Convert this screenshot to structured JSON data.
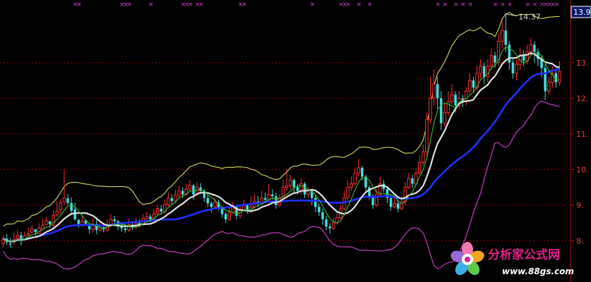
{
  "chart_data": {
    "type": "candlestick",
    "y_axis_side": "right",
    "ylim": [
      7.0,
      14.6
    ],
    "grid": "horizontal-dashed",
    "y_ticks": [
      "13.",
      "12.",
      "11.",
      "10.",
      "9.",
      "8."
    ],
    "y_tick_values": [
      13,
      12,
      11,
      10,
      9,
      8
    ],
    "last_price_label": "13.92",
    "last_price_value": 13.92,
    "high_label": "14.37",
    "high_value": 14.37,
    "high_index": 140,
    "n_bars": 156,
    "colors": {
      "background": "#000000",
      "up": "#ff3030",
      "down": "#40e0e0",
      "axis": "#b01010",
      "grid": "#8b0000",
      "upper_band": "#d8d860",
      "lower_band": "#c040c0",
      "ma_long": "#2030ff",
      "ma_mid": "#e0e0e0",
      "ma_short": "#30c030",
      "marker": "#cc44cc"
    },
    "signal_marker": "×",
    "signal_marker_indices": [
      20,
      21,
      33,
      34,
      35,
      41,
      50,
      51,
      52,
      54,
      55,
      66,
      67,
      86,
      94,
      95,
      96,
      99,
      102,
      121,
      123,
      126,
      128,
      130,
      137,
      139,
      141,
      146,
      148,
      150,
      151,
      152,
      153,
      154
    ],
    "candles": [
      [
        7.92,
        8.06,
        8.15,
        7.81
      ],
      [
        8.06,
        7.96,
        8.19,
        7.88
      ],
      [
        7.93,
        7.9,
        8.08,
        7.8
      ],
      [
        7.96,
        8.03,
        8.22,
        7.89
      ],
      [
        8.06,
        8.15,
        8.3,
        7.99
      ],
      [
        8.15,
        8.02,
        8.25,
        7.87
      ],
      [
        8.03,
        8.14,
        8.26,
        8.03
      ],
      [
        8.16,
        8.2,
        8.38,
        8.1
      ],
      [
        8.24,
        8.33,
        8.44,
        8.22
      ],
      [
        8.32,
        8.24,
        8.33,
        8.14
      ],
      [
        8.2,
        8.36,
        8.49,
        8.19
      ],
      [
        8.33,
        8.44,
        8.62,
        8.31
      ],
      [
        8.46,
        8.56,
        8.66,
        8.45
      ],
      [
        8.55,
        8.46,
        8.56,
        8.36
      ],
      [
        8.44,
        8.71,
        8.86,
        8.31
      ],
      [
        8.73,
        8.82,
        9.12,
        8.68
      ],
      [
        8.87,
        9.06,
        9.16,
        8.76
      ],
      [
        9.1,
        9.2,
        10.0,
        9.03
      ],
      [
        9.19,
        9.06,
        9.31,
        9.0
      ],
      [
        9.06,
        8.84,
        9.22,
        8.72
      ],
      [
        8.88,
        8.6,
        9.06,
        8.56
      ],
      [
        8.59,
        8.47,
        8.6,
        8.36
      ],
      [
        8.44,
        8.54,
        8.71,
        8.39
      ],
      [
        8.57,
        8.48,
        8.6,
        8.42
      ],
      [
        8.45,
        8.32,
        8.48,
        8.2
      ],
      [
        8.32,
        8.46,
        8.63,
        8.22
      ],
      [
        8.47,
        8.3,
        8.6,
        8.18
      ],
      [
        8.3,
        8.36,
        8.54,
        8.25
      ],
      [
        8.38,
        8.32,
        8.5,
        8.24
      ],
      [
        8.3,
        8.45,
        8.61,
        8.25
      ],
      [
        8.45,
        8.6,
        8.75,
        8.4
      ],
      [
        8.6,
        8.55,
        8.7,
        8.48
      ],
      [
        8.55,
        8.4,
        8.58,
        8.3
      ],
      [
        8.4,
        8.35,
        8.5,
        8.25
      ],
      [
        8.35,
        8.3,
        8.46,
        8.22
      ],
      [
        8.3,
        8.45,
        8.6,
        8.25
      ],
      [
        8.45,
        8.38,
        8.55,
        8.3
      ],
      [
        8.38,
        8.5,
        8.65,
        8.33
      ],
      [
        8.5,
        8.46,
        8.6,
        8.38
      ],
      [
        8.46,
        8.62,
        8.75,
        8.42
      ],
      [
        8.62,
        8.68,
        8.82,
        8.56
      ],
      [
        8.68,
        8.6,
        8.75,
        8.52
      ],
      [
        8.6,
        8.76,
        8.9,
        8.55
      ],
      [
        8.76,
        8.9,
        9.02,
        8.7
      ],
      [
        8.9,
        8.82,
        9.0,
        8.74
      ],
      [
        8.82,
        9.02,
        9.15,
        8.76
      ],
      [
        9.02,
        9.2,
        9.35,
        8.96
      ],
      [
        9.2,
        9.12,
        9.3,
        9.0
      ],
      [
        9.12,
        9.28,
        9.44,
        9.05
      ],
      [
        9.28,
        9.4,
        9.55,
        9.2
      ],
      [
        9.4,
        9.3,
        9.5,
        9.2
      ],
      [
        9.3,
        9.45,
        9.6,
        9.25
      ],
      [
        9.45,
        9.55,
        9.7,
        9.38
      ],
      [
        9.55,
        9.3,
        9.6,
        9.15
      ],
      [
        9.3,
        9.5,
        9.65,
        9.25
      ],
      [
        9.5,
        9.4,
        9.62,
        9.3
      ],
      [
        9.4,
        9.2,
        9.45,
        9.1
      ],
      [
        9.2,
        9.05,
        9.3,
        8.95
      ],
      [
        9.05,
        8.95,
        9.1,
        8.8
      ],
      [
        8.95,
        9.08,
        9.2,
        8.9
      ],
      [
        9.08,
        8.9,
        9.15,
        8.85
      ],
      [
        8.9,
        8.75,
        8.95,
        8.65
      ],
      [
        8.75,
        8.6,
        8.8,
        8.5
      ],
      [
        8.6,
        8.8,
        8.95,
        8.55
      ],
      [
        8.8,
        8.95,
        9.1,
        8.75
      ],
      [
        8.95,
        8.7,
        9.0,
        8.6
      ],
      [
        8.7,
        8.85,
        9.0,
        8.62
      ],
      [
        8.85,
        9.0,
        9.15,
        8.8
      ],
      [
        9.0,
        8.82,
        9.05,
        8.75
      ],
      [
        8.82,
        8.95,
        9.25,
        8.78
      ],
      [
        8.95,
        9.1,
        9.3,
        8.9
      ],
      [
        9.1,
        9.05,
        9.25,
        8.95
      ],
      [
        9.05,
        9.2,
        9.4,
        9.0
      ],
      [
        9.2,
        9.15,
        9.35,
        9.05
      ],
      [
        9.15,
        9.3,
        9.6,
        9.1
      ],
      [
        9.3,
        9.25,
        9.45,
        9.15
      ],
      [
        9.25,
        9.0,
        9.35,
        8.9
      ],
      [
        9.0,
        9.2,
        9.3,
        8.95
      ],
      [
        9.2,
        9.5,
        9.7,
        9.15
      ],
      [
        9.5,
        9.55,
        10.0,
        9.4
      ],
      [
        9.55,
        9.7,
        9.85,
        9.45
      ],
      [
        9.7,
        9.5,
        9.75,
        9.35
      ],
      [
        9.5,
        9.4,
        9.6,
        9.3
      ],
      [
        9.4,
        9.6,
        9.75,
        9.3
      ],
      [
        9.6,
        9.3,
        9.65,
        9.2
      ],
      [
        9.3,
        9.4,
        9.5,
        9.2
      ],
      [
        9.4,
        9.2,
        9.45,
        9.0
      ],
      [
        9.2,
        8.95,
        9.3,
        8.8
      ],
      [
        8.95,
        8.8,
        9.05,
        8.7
      ],
      [
        8.8,
        8.6,
        8.9,
        8.45
      ],
      [
        8.6,
        8.4,
        8.7,
        8.3
      ],
      [
        8.4,
        8.35,
        8.5,
        8.2
      ],
      [
        8.35,
        8.5,
        8.65,
        8.3
      ],
      [
        8.5,
        8.65,
        8.8,
        8.45
      ],
      [
        8.65,
        8.9,
        9.0,
        8.6
      ],
      [
        8.9,
        9.2,
        9.4,
        8.85
      ],
      [
        9.2,
        9.5,
        9.7,
        9.15
      ],
      [
        9.5,
        9.6,
        9.8,
        9.4
      ],
      [
        9.6,
        9.9,
        10.05,
        9.55
      ],
      [
        9.9,
        10.05,
        10.3,
        9.8
      ],
      [
        10.05,
        9.8,
        10.1,
        9.7
      ],
      [
        9.8,
        9.5,
        9.85,
        9.4
      ],
      [
        9.5,
        9.25,
        9.55,
        9.15
      ],
      [
        9.25,
        9.0,
        9.3,
        8.9
      ],
      [
        9.0,
        9.3,
        9.45,
        8.95
      ],
      [
        9.3,
        9.6,
        9.8,
        9.25
      ],
      [
        9.6,
        9.45,
        9.7,
        9.35
      ],
      [
        9.45,
        9.2,
        9.5,
        9.05
      ],
      [
        9.2,
        8.95,
        9.3,
        8.85
      ],
      [
        8.95,
        9.05,
        9.2,
        8.9
      ],
      [
        9.05,
        8.9,
        9.15,
        8.8
      ],
      [
        8.9,
        9.1,
        9.25,
        8.85
      ],
      [
        9.1,
        9.5,
        9.65,
        9.0
      ],
      [
        9.5,
        9.75,
        9.9,
        9.45
      ],
      [
        9.75,
        9.6,
        9.85,
        9.5
      ],
      [
        9.6,
        9.9,
        10.05,
        9.55
      ],
      [
        9.9,
        10.2,
        10.4,
        9.85
      ],
      [
        10.2,
        10.5,
        10.7,
        10.1
      ],
      [
        10.5,
        11.4,
        11.6,
        10.4
      ],
      [
        11.4,
        12.0,
        12.6,
        11.3
      ],
      [
        12.0,
        12.4,
        12.8,
        11.8
      ],
      [
        12.4,
        12.0,
        12.6,
        11.7
      ],
      [
        12.0,
        11.3,
        12.2,
        11.1
      ],
      [
        11.3,
        11.6,
        11.9,
        11.2
      ],
      [
        11.6,
        11.9,
        12.2,
        11.5
      ],
      [
        11.9,
        12.1,
        12.4,
        11.8
      ],
      [
        12.1,
        11.8,
        12.2,
        11.6
      ],
      [
        11.8,
        12.0,
        12.2,
        11.7
      ],
      [
        12.0,
        11.9,
        12.1,
        11.75
      ],
      [
        11.9,
        12.2,
        12.3,
        11.8
      ],
      [
        12.2,
        12.5,
        12.7,
        12.1
      ],
      [
        12.5,
        12.3,
        12.6,
        12.15
      ],
      [
        12.3,
        12.7,
        12.9,
        12.2
      ],
      [
        12.7,
        12.9,
        13.1,
        12.55
      ],
      [
        12.9,
        12.6,
        13.0,
        12.4
      ],
      [
        12.6,
        12.9,
        13.1,
        12.45
      ],
      [
        12.9,
        13.2,
        13.4,
        12.8
      ],
      [
        13.2,
        13.0,
        13.3,
        12.85
      ],
      [
        13.0,
        13.6,
        13.8,
        12.9
      ],
      [
        13.6,
        13.9,
        14.2,
        13.4
      ],
      [
        13.9,
        13.5,
        14.37,
        13.3
      ],
      [
        13.5,
        13.0,
        13.6,
        12.8
      ],
      [
        13.0,
        12.7,
        13.1,
        12.55
      ],
      [
        12.7,
        12.95,
        13.1,
        12.5
      ],
      [
        12.95,
        13.2,
        13.4,
        12.8
      ],
      [
        13.2,
        13.05,
        13.35,
        12.9
      ],
      [
        13.05,
        13.3,
        13.5,
        12.95
      ],
      [
        13.3,
        13.5,
        13.7,
        13.2
      ],
      [
        13.5,
        13.3,
        13.6,
        13.0
      ],
      [
        13.3,
        13.1,
        13.4,
        12.9
      ],
      [
        13.1,
        12.85,
        13.2,
        12.6
      ],
      [
        12.85,
        12.2,
        12.95,
        11.95
      ],
      [
        12.2,
        12.45,
        12.6,
        12.1
      ],
      [
        12.45,
        12.7,
        12.9,
        12.3
      ],
      [
        12.7,
        12.45,
        12.85,
        12.3
      ],
      [
        12.45,
        12.75,
        13.05,
        12.35
      ]
    ]
  },
  "watermark": {
    "title": "分析家公式网",
    "url": "www.88gs.com"
  }
}
